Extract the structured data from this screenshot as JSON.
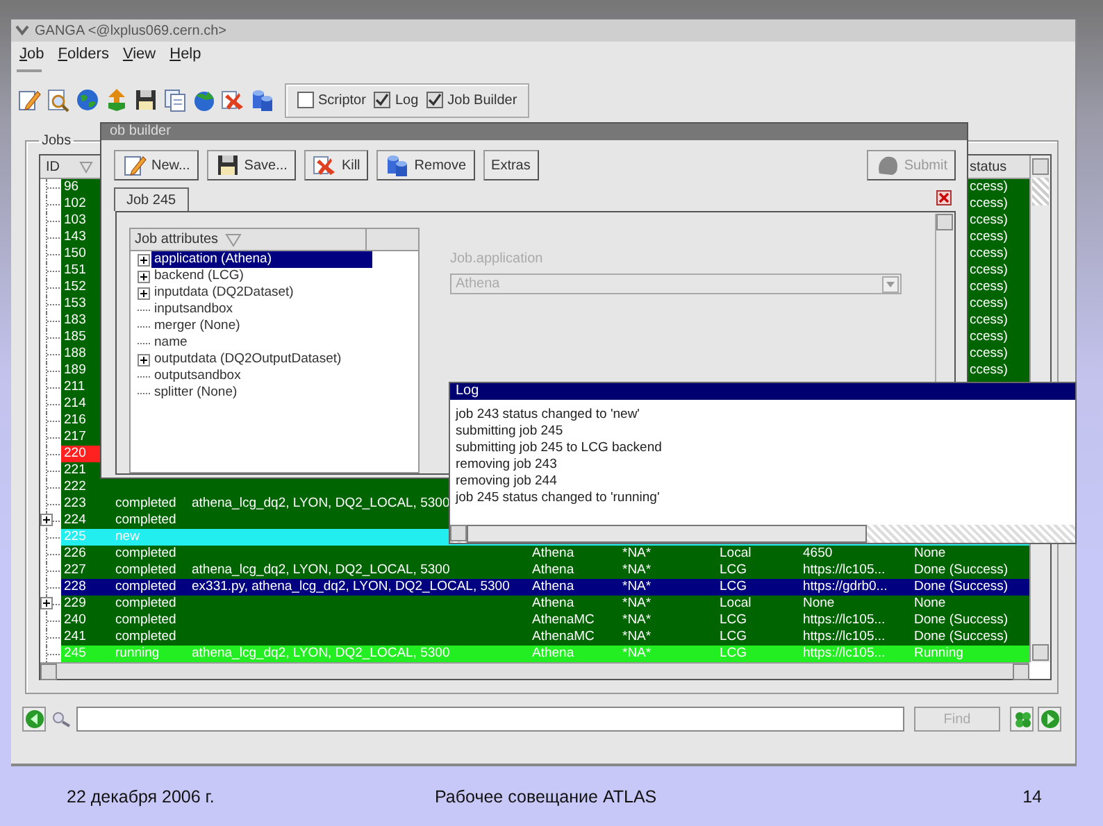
{
  "window": {
    "title": "GANGA <@lxplus069.cern.ch>"
  },
  "menu": [
    "Job",
    "Folders",
    "View",
    "Help"
  ],
  "toggles": [
    {
      "label": "Scriptor",
      "checked": false
    },
    {
      "label": "Log",
      "checked": true
    },
    {
      "label": "Job Builder",
      "checked": true
    }
  ],
  "jobs": {
    "title": "Jobs",
    "id_header": "ID",
    "status_header": "status",
    "rows": [
      {
        "id": "96",
        "selected": false,
        "color": "#006400",
        "expandable": false,
        "status": "ccess)",
        "status_clipped": true
      },
      {
        "id": "102",
        "selected": false,
        "color": "#006400",
        "expandable": false,
        "status": "ccess)",
        "status_clipped": true
      },
      {
        "id": "103",
        "selected": false,
        "color": "#006400",
        "expandable": false,
        "status": "ccess)",
        "status_clipped": true
      },
      {
        "id": "143",
        "selected": false,
        "color": "#006400",
        "expandable": false,
        "status": "ccess)",
        "status_clipped": true
      },
      {
        "id": "150",
        "selected": false,
        "color": "#006400",
        "expandable": false,
        "status": "ccess)",
        "status_clipped": true
      },
      {
        "id": "151",
        "selected": false,
        "color": "#006400",
        "expandable": false,
        "status": "ccess)",
        "status_clipped": true
      },
      {
        "id": "152",
        "selected": false,
        "color": "#006400",
        "expandable": false,
        "status": "ccess)",
        "status_clipped": true
      },
      {
        "id": "153",
        "selected": false,
        "color": "#006400",
        "expandable": false,
        "status": "ccess)",
        "status_clipped": true
      },
      {
        "id": "183",
        "selected": false,
        "color": "#006400",
        "expandable": false,
        "status": "ccess)",
        "status_clipped": true
      },
      {
        "id": "185",
        "selected": false,
        "color": "#006400",
        "expandable": false,
        "status": "ccess)",
        "status_clipped": true
      },
      {
        "id": "188",
        "selected": false,
        "color": "#006400",
        "expandable": false,
        "status": "ccess)",
        "status_clipped": true
      },
      {
        "id": "189",
        "selected": false,
        "color": "#006400",
        "expandable": false,
        "status": "ccess)",
        "status_clipped": true
      },
      {
        "id": "211",
        "selected": false,
        "color": "#006400",
        "expandable": false
      },
      {
        "id": "214",
        "selected": false,
        "color": "#006400",
        "expandable": false
      },
      {
        "id": "216",
        "selected": false,
        "color": "#006400",
        "expandable": false
      },
      {
        "id": "217",
        "selected": false,
        "color": "#006400",
        "expandable": false
      },
      {
        "id": "220",
        "selected": false,
        "color": "#ff2020",
        "expandable": false
      },
      {
        "id": "221",
        "selected": false,
        "color": "#006400",
        "expandable": false
      },
      {
        "id": "222",
        "selected": false,
        "color": "#006400",
        "expandable": false
      },
      {
        "id": "223",
        "selected": false,
        "color": "#006400",
        "expandable": false,
        "state": "completed",
        "name": "athena_lcg_dq2, LYON, DQ2_LOCAL, 5300"
      },
      {
        "id": "224",
        "selected": false,
        "color": "#006400",
        "expandable": true,
        "state": "completed"
      },
      {
        "id": "225",
        "selected": false,
        "color": "#22eef0",
        "expandable": false,
        "state": "new"
      },
      {
        "id": "226",
        "selected": false,
        "color": "#006400",
        "expandable": false,
        "state": "completed",
        "application": "Athena",
        "column_5": "*NA*",
        "backend": "Local",
        "backend_id": "4650",
        "status": "None"
      },
      {
        "id": "227",
        "selected": false,
        "color": "#006400",
        "expandable": false,
        "state": "completed",
        "name": "athena_lcg_dq2, LYON, DQ2_LOCAL, 5300",
        "application": "Athena",
        "column_5": "*NA*",
        "backend": "LCG",
        "backend_id": "https://lc105...",
        "status": "Done (Success)"
      },
      {
        "id": "228",
        "selected": true,
        "expandable": false,
        "state": "completed",
        "name": "ex331.py, athena_lcg_dq2, LYON, DQ2_LOCAL, 5300",
        "application": "Athena",
        "column_5": "*NA*",
        "backend": "LCG",
        "backend_id": "https://gdrb0...",
        "status": "Done (Success)"
      },
      {
        "id": "229",
        "selected": false,
        "color": "#006400",
        "expandable": true,
        "state": "completed",
        "application": "Athena",
        "column_5": "*NA*",
        "backend": "Local",
        "backend_id": "None",
        "status": "None"
      },
      {
        "id": "240",
        "selected": false,
        "color": "#006400",
        "expandable": false,
        "state": "completed",
        "application": "AthenaMC",
        "column_5": "*NA*",
        "backend": "LCG",
        "backend_id": "https://lc105...",
        "status": "Done (Success)"
      },
      {
        "id": "241",
        "selected": false,
        "color": "#006400",
        "expandable": false,
        "state": "completed",
        "application": "AthenaMC",
        "column_5": "*NA*",
        "backend": "LCG",
        "backend_id": "https://lc105...",
        "status": "Done (Success)"
      },
      {
        "id": "245",
        "selected": false,
        "color": "#22ee22",
        "expandable": false,
        "state": "running",
        "name": "athena_lcg_dq2, LYON, DQ2_LOCAL, 5300",
        "application": "Athena",
        "column_5": "*NA*",
        "backend": "LCG",
        "backend_id": "https://lc105...",
        "status": "Running"
      }
    ]
  },
  "job_builder": {
    "title": "ob builder",
    "buttons": [
      {
        "label": "New...",
        "kind": "new"
      },
      {
        "label": "Save...",
        "kind": "save"
      },
      {
        "label": "Kill",
        "kind": "kill"
      },
      {
        "label": "Remove",
        "kind": "remove"
      },
      {
        "label": "Extras",
        "kind": "plain"
      }
    ],
    "submit": {
      "label": "Submit",
      "disabled": true
    },
    "tabs": [
      {
        "label": "Job 245",
        "selected": true
      }
    ],
    "attributes_header": "Job attributes",
    "attributes": [
      {
        "label": "application (Athena)",
        "expandable": true,
        "selected": true
      },
      {
        "label": "backend (LCG)",
        "expandable": true,
        "selected": false
      },
      {
        "label": "inputdata (DQ2Dataset)",
        "expandable": true,
        "selected": false
      },
      {
        "label": "inputsandbox",
        "expandable": false,
        "selected": false
      },
      {
        "label": "merger (None)",
        "expandable": false,
        "selected": false
      },
      {
        "label": "name",
        "expandable": false,
        "selected": false
      },
      {
        "label": "outputdata (DQ2OutputDataset)",
        "expandable": true,
        "selected": false
      },
      {
        "label": "outputsandbox",
        "expandable": false,
        "selected": false
      },
      {
        "label": "splitter (None)",
        "expandable": false,
        "selected": false
      }
    ],
    "field": {
      "label": "Job.application",
      "value": "Athena",
      "disabled": true
    }
  },
  "log": {
    "title": "Log",
    "lines": [
      "job 243 status changed to 'new'",
      "submitting job 245",
      "submitting job 245 to LCG backend",
      "removing job 243",
      "removing job 244",
      "job 245 status changed to 'running'"
    ]
  },
  "search_bar": {
    "button": "Find",
    "button_disabled": true
  },
  "footer": {
    "date": "22 декабря 2006 г.",
    "title": "Рабочее совещание ATLAS",
    "page": "14"
  }
}
